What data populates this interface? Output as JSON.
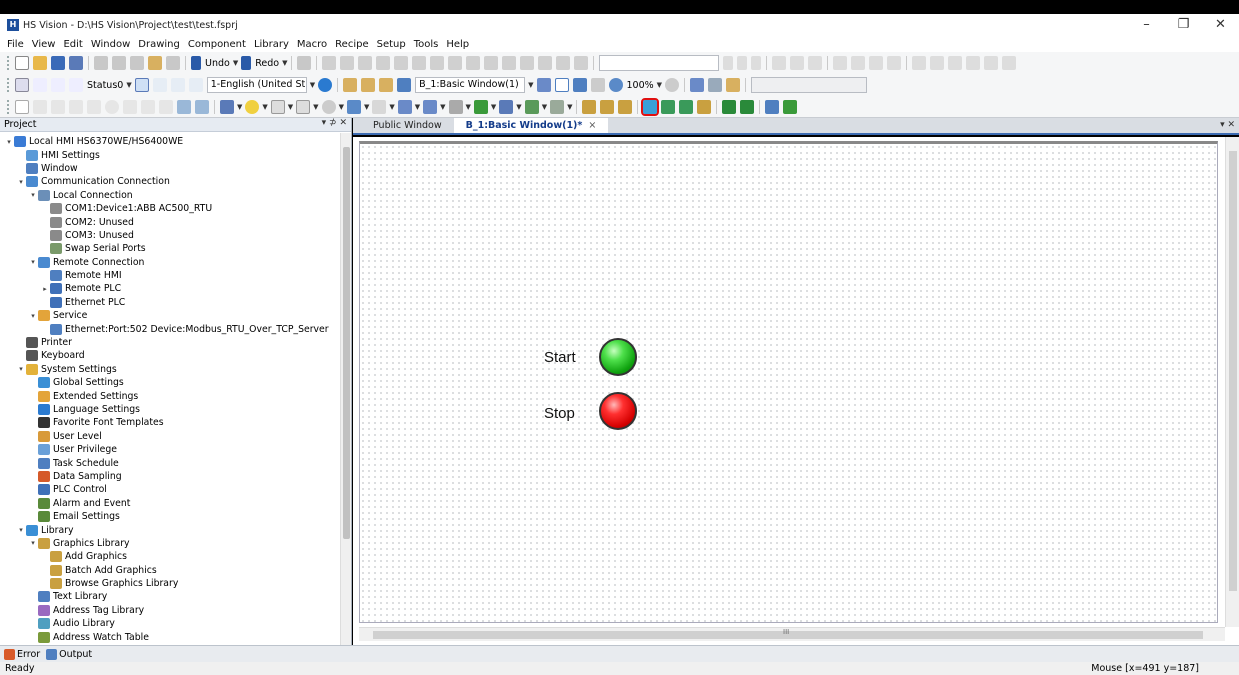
{
  "window": {
    "title": "HS Vision - D:\\HS Vision\\Project\\test\\test.fsprj",
    "minimize": "–",
    "restore": "❐",
    "close": "✕"
  },
  "menu": [
    "File",
    "View",
    "Edit",
    "Window",
    "Drawing",
    "Component",
    "Library",
    "Macro",
    "Recipe",
    "Setup",
    "Tools",
    "Help"
  ],
  "toolbar": {
    "undo": "Undo",
    "redo": "Redo",
    "status_combo": "Status0",
    "language_combo": "1-English (United St",
    "window_combo": "B_1:Basic Window(1)",
    "zoom": "100%"
  },
  "project_panel": {
    "title": "Project",
    "pin": "▾ ⊅ ✕",
    "tree": [
      {
        "label": "Local HMI HS6370WE/HS6400WE",
        "level": 0,
        "exp": "▾",
        "icon": "monitor-icon",
        "color": "#3a7bd5"
      },
      {
        "label": "HMI Settings",
        "level": 1,
        "exp": "",
        "icon": "settings-icon",
        "color": "#5a9ad8"
      },
      {
        "label": "Window",
        "level": 1,
        "exp": "",
        "icon": "window-icon",
        "color": "#4f7fc0"
      },
      {
        "label": "Communication Connection",
        "level": 1,
        "exp": "▾",
        "icon": "network-icon",
        "color": "#4a8ad0"
      },
      {
        "label": "Local Connection",
        "level": 2,
        "exp": "▾",
        "icon": "plug-icon",
        "color": "#6b8fb8"
      },
      {
        "label": "COM1:Device1:ABB AC500_RTU",
        "level": 3,
        "exp": "",
        "icon": "serial-icon",
        "color": "#8a8a8a"
      },
      {
        "label": "COM2: Unused",
        "level": 3,
        "exp": "",
        "icon": "serial-icon",
        "color": "#8a8a8a"
      },
      {
        "label": "COM3: Unused",
        "level": 3,
        "exp": "",
        "icon": "serial-icon",
        "color": "#8a8a8a"
      },
      {
        "label": "Swap Serial Ports",
        "level": 3,
        "exp": "",
        "icon": "swap-icon",
        "color": "#7a9a6a"
      },
      {
        "label": "Remote Connection",
        "level": 2,
        "exp": "▾",
        "icon": "network-icon",
        "color": "#4a8ad0"
      },
      {
        "label": "Remote HMI",
        "level": 3,
        "exp": "",
        "icon": "monitor-icon",
        "color": "#4f7fc0"
      },
      {
        "label": "Remote PLC",
        "level": 3,
        "exp": "▸",
        "icon": "plc-icon",
        "color": "#3f70b8"
      },
      {
        "label": "Ethernet PLC",
        "level": 3,
        "exp": "",
        "icon": "plc-icon",
        "color": "#3f70b8"
      },
      {
        "label": "Service",
        "level": 2,
        "exp": "▾",
        "icon": "service-icon",
        "color": "#e3a43a"
      },
      {
        "label": "Ethernet:Port:502 Device:Modbus_RTU_Over_TCP_Server",
        "level": 3,
        "exp": "",
        "icon": "monitor-icon",
        "color": "#4f7fc0"
      },
      {
        "label": "Printer",
        "level": 1,
        "exp": "",
        "icon": "printer-icon",
        "color": "#555555"
      },
      {
        "label": "Keyboard",
        "level": 1,
        "exp": "",
        "icon": "keyboard-icon",
        "color": "#555555"
      },
      {
        "label": "System Settings",
        "level": 1,
        "exp": "▾",
        "icon": "gear-icon",
        "color": "#e3b23a"
      },
      {
        "label": "Global Settings",
        "level": 2,
        "exp": "",
        "icon": "globe-icon",
        "color": "#3a8fd5"
      },
      {
        "label": "Extended Settings",
        "level": 2,
        "exp": "",
        "icon": "extend-icon",
        "color": "#e3a43a"
      },
      {
        "label": "Language Settings",
        "level": 2,
        "exp": "",
        "icon": "language-icon",
        "color": "#2a7ad0"
      },
      {
        "label": "Favorite Font Templates",
        "level": 2,
        "exp": "",
        "icon": "font-icon",
        "color": "#333333"
      },
      {
        "label": "User Level",
        "level": 2,
        "exp": "",
        "icon": "user-icon",
        "color": "#d89a3a"
      },
      {
        "label": "User Privilege",
        "level": 2,
        "exp": "",
        "icon": "user-privilege-icon",
        "color": "#6aa0d8"
      },
      {
        "label": "Task Schedule",
        "level": 2,
        "exp": "",
        "icon": "schedule-icon",
        "color": "#4f7fc0"
      },
      {
        "label": "Data Sampling",
        "level": 2,
        "exp": "",
        "icon": "chart-icon",
        "color": "#d55a2a"
      },
      {
        "label": "PLC Control",
        "level": 2,
        "exp": "",
        "icon": "plc-icon",
        "color": "#3f70b8"
      },
      {
        "label": "Alarm and Event",
        "level": 2,
        "exp": "",
        "icon": "alarm-icon",
        "color": "#5a8a3a"
      },
      {
        "label": "Email Settings",
        "level": 2,
        "exp": "",
        "icon": "email-icon",
        "color": "#5a8a3a"
      },
      {
        "label": "Library",
        "level": 1,
        "exp": "▾",
        "icon": "library-icon",
        "color": "#3a8fd5"
      },
      {
        "label": "Graphics Library",
        "level": 2,
        "exp": "▾",
        "icon": "graphics-icon",
        "color": "#c9a040"
      },
      {
        "label": "Add Graphics",
        "level": 3,
        "exp": "",
        "icon": "add-graphics-icon",
        "color": "#c9a040"
      },
      {
        "label": "Batch Add Graphics",
        "level": 3,
        "exp": "",
        "icon": "batch-graphics-icon",
        "color": "#c9a040"
      },
      {
        "label": "Browse Graphics Library",
        "level": 3,
        "exp": "",
        "icon": "browse-icon",
        "color": "#c9a040"
      },
      {
        "label": "Text Library",
        "level": 2,
        "exp": "",
        "icon": "text-icon",
        "color": "#4f7fc0"
      },
      {
        "label": "Address Tag Library",
        "level": 2,
        "exp": "",
        "icon": "tag-icon",
        "color": "#9a6ac0"
      },
      {
        "label": "Audio Library",
        "level": 2,
        "exp": "",
        "icon": "audio-icon",
        "color": "#4f9fc0"
      },
      {
        "label": "Address Watch Table",
        "level": 2,
        "exp": "",
        "icon": "watch-icon",
        "color": "#7a9a3a"
      }
    ]
  },
  "doc_tabs": {
    "tab1": "Public Window",
    "tab2": "B_1:Basic Window(1)*",
    "tab2_close": "×",
    "panel_close": "▾ ✕"
  },
  "canvas": {
    "start_label": "Start",
    "stop_label": "Stop",
    "start_color": "#1fc41f",
    "stop_color": "#e01010",
    "hscroll_mark": "III"
  },
  "bottom_tabs": {
    "error": "Error",
    "output": "Output"
  },
  "status": {
    "ready": "Ready",
    "mouse": "Mouse [x=491 y=187]"
  },
  "colors": {
    "highlight": "#e01010",
    "accent": "#3c6bb2"
  }
}
